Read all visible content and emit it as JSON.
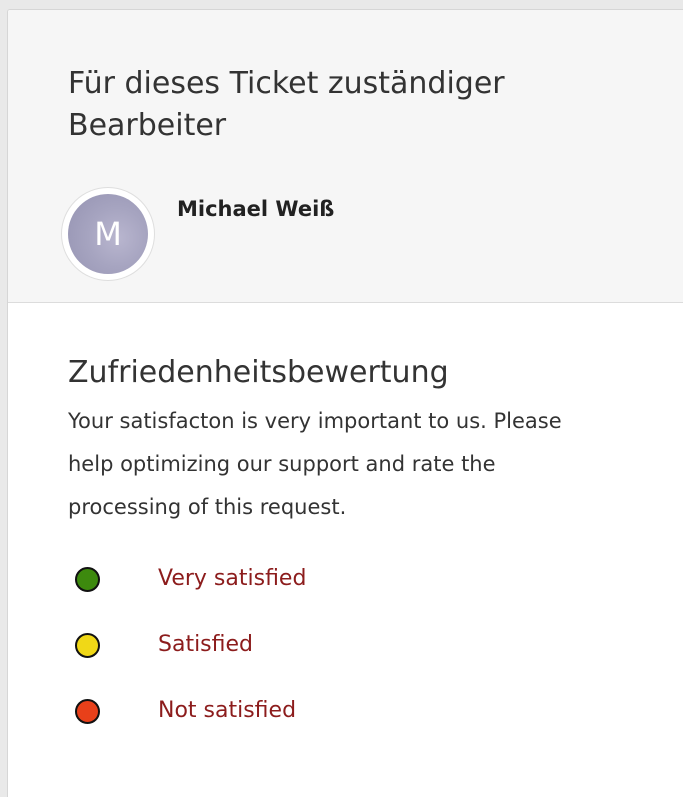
{
  "agent_section": {
    "title": "Für dieses Ticket zuständiger Bearbeiter",
    "avatar_initial": "M",
    "agent_name": "Michael Weiß"
  },
  "rating_section": {
    "title": "Zufriedenheitsbewertung",
    "description": "Your satisfacton is very important to us. Please help optimizing our support and rate the processing of this request.",
    "options": [
      {
        "label": "Very satisfied",
        "color": "#3d8a0e"
      },
      {
        "label": "Satisfied",
        "color": "#f0d817"
      },
      {
        "label": "Not satisfied",
        "color": "#e8401a"
      }
    ],
    "link_color": "#8c1c1c"
  }
}
